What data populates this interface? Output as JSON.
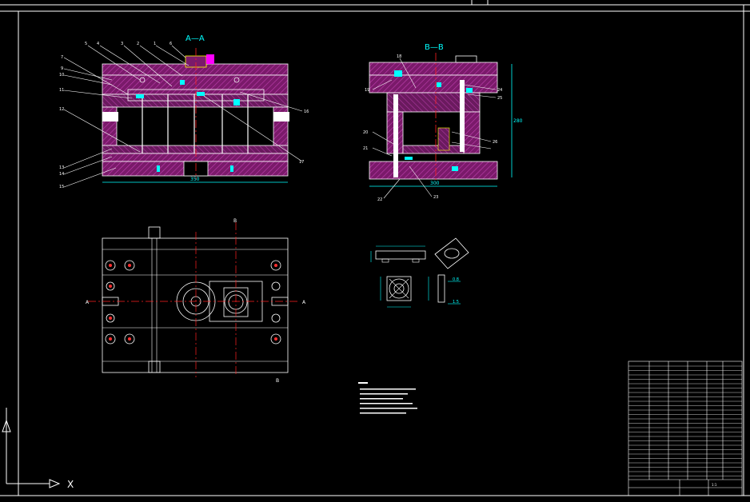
{
  "views": {
    "section_aa": {
      "title": "A—A",
      "width_dim": "350"
    },
    "section_bb": {
      "title": "B—B",
      "width_dim": "300",
      "height_dim": "280"
    },
    "plan": {
      "cut_left": "A",
      "cut_right": "A",
      "cut_top": "B",
      "cut_bottom": "B"
    },
    "part": {
      "dim_1": "0.8",
      "dim_2": "1.5"
    }
  },
  "labels_aa": [
    "7",
    "5",
    "4",
    "3",
    "2",
    "1",
    "6",
    "9",
    "10",
    "11",
    "12",
    "13",
    "14",
    "15",
    "16",
    "17"
  ],
  "labels_bb": [
    "18",
    "19",
    "20",
    "21",
    "22",
    "23",
    "24",
    "25",
    "26"
  ],
  "title_block": {
    "dwg_no": "",
    "scale": "1:1"
  },
  "axis": {
    "x": "X"
  },
  "colors": {
    "plate": "#7a1a6a",
    "hatch": "#c03cb0",
    "outline": "#ffffff",
    "dimension": "#00ffff",
    "center": "#ff2020",
    "leader": "#ffffff",
    "accent": "#ff00ff",
    "yellow": "#ffff00"
  }
}
